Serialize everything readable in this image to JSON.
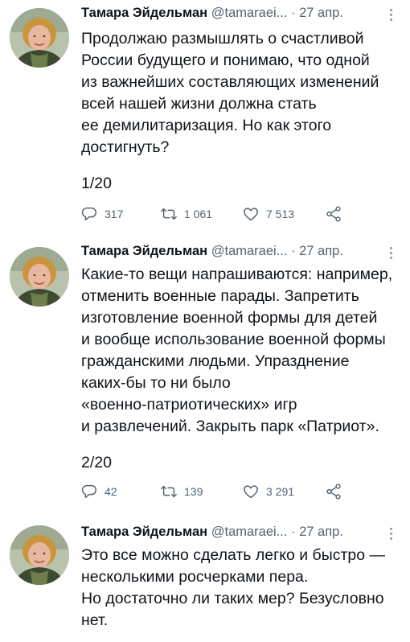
{
  "tweets": [
    {
      "author": "Тамара Эйдельман",
      "handle": "@tamaraei...",
      "separator": "·",
      "date": "27 апр.",
      "lines": [
        "Продолжаю размышлять о счастливой",
        "России будущего и понимаю, что одной",
        "из важнейших составляющих изменений",
        "всей нашей жизни должна стать",
        "ее демилитаризация. Но как этого",
        "достигнуть?"
      ],
      "counter": "1/20",
      "replies": "317",
      "retweets": "1 061",
      "likes": "7 513"
    },
    {
      "author": "Тамара Эйдельман",
      "handle": "@tamaraei...",
      "separator": "·",
      "date": "27 апр.",
      "lines": [
        "Какие-то вещи напрашиваются: например,",
        "отменить военные парады. Запретить",
        "изготовление военной формы для детей",
        "и вообще использование военной формы",
        "гражданскими людьми. Упразднение",
        "каких-бы то ни было",
        "«военно-патриотических» игр",
        "и развлечений. Закрыть парк «Патриот»."
      ],
      "counter": "2/20",
      "replies": "42",
      "retweets": "139",
      "likes": "3 291"
    },
    {
      "author": "Тамара Эйдельман",
      "handle": "@tamaraei...",
      "separator": "·",
      "date": "27 апр.",
      "lines": [
        "Это все можно сделать легко и быстро —",
        "несколькими росчерками пера.",
        "Но достаточно ли таких мер? Безусловно",
        "нет."
      ]
    }
  ],
  "icons": {
    "reply": "reply-icon",
    "retweet": "retweet-icon",
    "like": "heart-icon",
    "share": "share-icon",
    "more": "more-options-icon"
  },
  "colors": {
    "text": "#0f1419",
    "secondary": "#536471",
    "background": "#ffffff"
  }
}
